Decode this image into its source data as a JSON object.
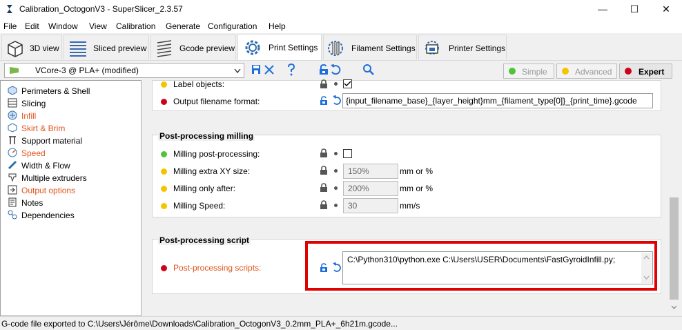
{
  "window": {
    "title": "Calibration_OctogonV3 - SuperSlicer_2.3.57",
    "minimize": "—",
    "maximize": "☐",
    "close": "✕"
  },
  "menu": [
    "File",
    "Edit",
    "Window",
    "View",
    "Calibration",
    "Generate",
    "Configuration",
    "Help"
  ],
  "tabs": [
    {
      "label": "3D view",
      "icon": "cube-icon"
    },
    {
      "label": "Sliced preview",
      "icon": "layers-icon"
    },
    {
      "label": "Gcode preview",
      "icon": "gcode-layers-icon"
    },
    {
      "label": "Print Settings",
      "icon": "gear-icon",
      "active": true
    },
    {
      "label": "Filament Settings",
      "icon": "filament-spool-icon"
    },
    {
      "label": "Printer Settings",
      "icon": "printer-icon"
    }
  ],
  "preset": {
    "value": "VCore-3 @ PLA+ (modified)"
  },
  "modes": {
    "simple": "Simple",
    "advanced": "Advanced",
    "expert": "Expert"
  },
  "sidebar": [
    {
      "label": "Perimeters & Shell",
      "modified": false
    },
    {
      "label": "Slicing",
      "modified": false
    },
    {
      "label": "Infill",
      "modified": true
    },
    {
      "label": "Skirt & Brim",
      "modified": true
    },
    {
      "label": "Support material",
      "modified": false
    },
    {
      "label": "Speed",
      "modified": true
    },
    {
      "label": "Width & Flow",
      "modified": false
    },
    {
      "label": "Multiple extruders",
      "modified": false
    },
    {
      "label": "Output options",
      "modified": true
    },
    {
      "label": "Notes",
      "modified": false
    },
    {
      "label": "Dependencies",
      "modified": false
    }
  ],
  "output": {
    "label_objects": "Label objects:",
    "filename_format_label": "Output filename format:",
    "filename_format_value": "{input_filename_base}_{layer_height}mm_{filament_type[0]}_{print_time}.gcode"
  },
  "milling": {
    "title": "Post-processing milling",
    "post_processing": "Milling post-processing:",
    "extra_xy_label": "Milling extra XY size:",
    "extra_xy_value": "150%",
    "extra_xy_unit": "mm or %",
    "only_after_label": "Milling only after:",
    "only_after_value": "200%",
    "only_after_unit": "mm or %",
    "speed_label": "Milling Speed:",
    "speed_value": "30",
    "speed_unit": "mm/s"
  },
  "script": {
    "title": "Post-processing script",
    "label": "Post-processing scripts:",
    "value": "C:\\Python310\\python.exe C:\\Users\\USER\\Documents\\FastGyroidInfill.py;"
  },
  "status": "G-code file exported to C:\\Users\\Jérôme\\Downloads\\Calibration_OctogonV3_0.2mm_PLA+_6h21m.gcode...",
  "colors": {
    "accent": "#e1541c",
    "lock_blue": "#1e6fd9",
    "green": "#4fc43a",
    "yellow": "#f5c400",
    "red": "#d0021b",
    "highlight_box": "#e00000"
  }
}
